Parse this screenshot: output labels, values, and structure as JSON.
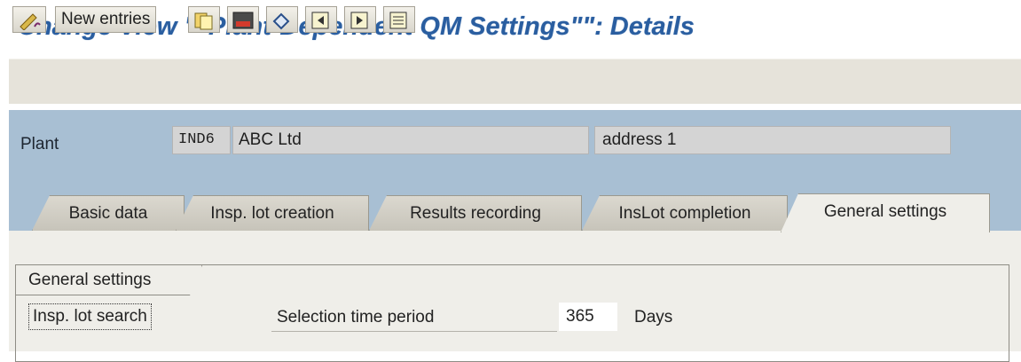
{
  "window": {
    "title": "Change View \"\"Plant-Dependent QM Settings\"\": Details"
  },
  "toolbar": {
    "new_entries_label": "New entries",
    "icons": [
      "edit-display-toggle-icon",
      "copy-as-icon",
      "delete-icon",
      "undo-change-icon",
      "previous-entry-icon",
      "next-entry-icon",
      "select-all-icon"
    ]
  },
  "header": {
    "plant_label": "Plant",
    "plant_code": "IND6",
    "plant_name": "ABC Ltd",
    "plant_address": "address 1"
  },
  "tabs": [
    {
      "label": "Basic data",
      "active": false
    },
    {
      "label": "Insp. lot creation",
      "active": false
    },
    {
      "label": "Results recording",
      "active": false
    },
    {
      "label": "InsLot completion",
      "active": false
    },
    {
      "label": "General settings",
      "active": true
    }
  ],
  "general_settings": {
    "group_title": "General settings",
    "insp_lot_search_label": "Insp. lot search",
    "selection_time_label": "Selection time period",
    "selection_time_value": "365",
    "unit": "Days"
  },
  "colors": {
    "title": "#2a5ea0",
    "header_panel": "#a8bfd3",
    "content_bg": "#efeee9"
  }
}
